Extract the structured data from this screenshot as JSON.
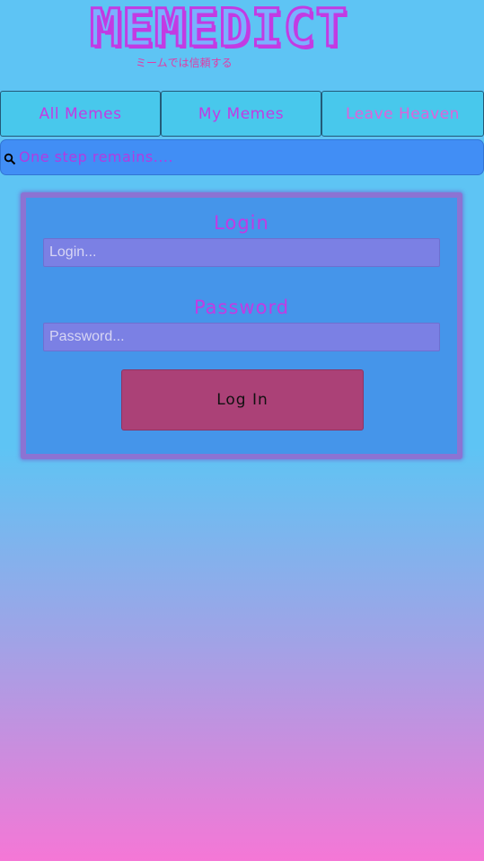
{
  "header": {
    "logo_text": "MEMEDICT",
    "tagline": "ミームでは信頼する"
  },
  "nav": {
    "items": [
      {
        "label": "All Memes"
      },
      {
        "label": "My Memes"
      },
      {
        "label": "Leave Heaven"
      }
    ]
  },
  "search": {
    "icon": "search-icon",
    "placeholder": "One step remains...."
  },
  "login_form": {
    "login_label": "Login",
    "login_placeholder": "Login...",
    "password_label": "Password",
    "password_placeholder": "Password...",
    "submit_label": "Log In"
  },
  "colors": {
    "accent_purple": "#c23be3",
    "tagline_pink": "#e23aa6",
    "nav_bg": "#48c8ec",
    "search_bg": "#418ef5",
    "card_bg": "#4595ea",
    "input_bg": "#7b80e4",
    "button_bg": "#ab4177",
    "gradient_top": "#5ec4f4",
    "gradient_bottom": "#f577d6"
  }
}
